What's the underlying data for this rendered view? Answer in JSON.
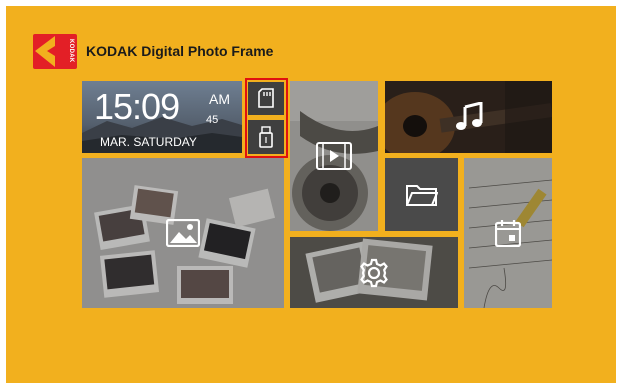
{
  "header": {
    "title": "KODAK Digital Photo Frame",
    "logo_text": "KODAK"
  },
  "clock": {
    "time": "15:09",
    "ampm": "AM",
    "seconds": "45",
    "date": "MAR. SATURDAY"
  },
  "tiles": [
    {
      "name": "sd-card",
      "icon": "sd-card-icon"
    },
    {
      "name": "usb",
      "icon": "usb-icon"
    },
    {
      "name": "video",
      "icon": "video-icon"
    },
    {
      "name": "music",
      "icon": "music-note-icon"
    },
    {
      "name": "photo",
      "icon": "image-icon"
    },
    {
      "name": "file",
      "icon": "folder-icon"
    },
    {
      "name": "calendar",
      "icon": "calendar-icon"
    },
    {
      "name": "settings",
      "icon": "gear-icon"
    }
  ],
  "colors": {
    "background": "#f2b01e",
    "brand_red": "#e31f26",
    "highlight": "#e01010"
  }
}
